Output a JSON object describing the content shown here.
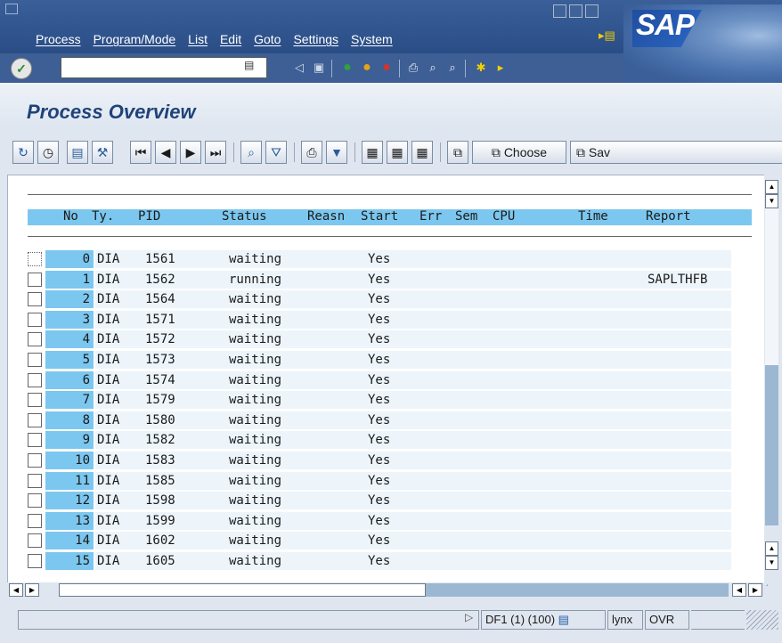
{
  "menubar": {
    "items": [
      "Process",
      "Program/Mode",
      "List",
      "Edit",
      "Goto",
      "Settings",
      "System"
    ],
    "logo_text": "SAP"
  },
  "page": {
    "title": "Process Overview"
  },
  "toolbar2": {
    "choose_label": "Choose",
    "save_label": "Sav"
  },
  "list": {
    "headers": [
      "No",
      "Ty.",
      "PID",
      "Status",
      "Reasn",
      "Start",
      "Err",
      "Sem",
      "CPU",
      "Time",
      "Report"
    ],
    "rows": [
      {
        "no": "0",
        "ty": "DIA",
        "pid": "1561",
        "status": "waiting",
        "start": "Yes",
        "report": ""
      },
      {
        "no": "1",
        "ty": "DIA",
        "pid": "1562",
        "status": "running",
        "start": "Yes",
        "report": "SAPLTHFB"
      },
      {
        "no": "2",
        "ty": "DIA",
        "pid": "1564",
        "status": "waiting",
        "start": "Yes",
        "report": ""
      },
      {
        "no": "3",
        "ty": "DIA",
        "pid": "1571",
        "status": "waiting",
        "start": "Yes",
        "report": ""
      },
      {
        "no": "4",
        "ty": "DIA",
        "pid": "1572",
        "status": "waiting",
        "start": "Yes",
        "report": ""
      },
      {
        "no": "5",
        "ty": "DIA",
        "pid": "1573",
        "status": "waiting",
        "start": "Yes",
        "report": ""
      },
      {
        "no": "6",
        "ty": "DIA",
        "pid": "1574",
        "status": "waiting",
        "start": "Yes",
        "report": ""
      },
      {
        "no": "7",
        "ty": "DIA",
        "pid": "1579",
        "status": "waiting",
        "start": "Yes",
        "report": ""
      },
      {
        "no": "8",
        "ty": "DIA",
        "pid": "1580",
        "status": "waiting",
        "start": "Yes",
        "report": ""
      },
      {
        "no": "9",
        "ty": "DIA",
        "pid": "1582",
        "status": "waiting",
        "start": "Yes",
        "report": ""
      },
      {
        "no": "10",
        "ty": "DIA",
        "pid": "1583",
        "status": "waiting",
        "start": "Yes",
        "report": ""
      },
      {
        "no": "11",
        "ty": "DIA",
        "pid": "1585",
        "status": "waiting",
        "start": "Yes",
        "report": ""
      },
      {
        "no": "12",
        "ty": "DIA",
        "pid": "1598",
        "status": "waiting",
        "start": "Yes",
        "report": ""
      },
      {
        "no": "13",
        "ty": "DIA",
        "pid": "1599",
        "status": "waiting",
        "start": "Yes",
        "report": ""
      },
      {
        "no": "14",
        "ty": "DIA",
        "pid": "1602",
        "status": "waiting",
        "start": "Yes",
        "report": ""
      },
      {
        "no": "15",
        "ty": "DIA",
        "pid": "1605",
        "status": "waiting",
        "start": "Yes",
        "report": ""
      }
    ]
  },
  "statusbar": {
    "system": "DF1 (1) (100)",
    "server": "lynx",
    "mode": "OVR"
  },
  "colors": {
    "menubar": "#2a4d86",
    "list_header": "#7cc7ef",
    "title": "#1f4378"
  }
}
